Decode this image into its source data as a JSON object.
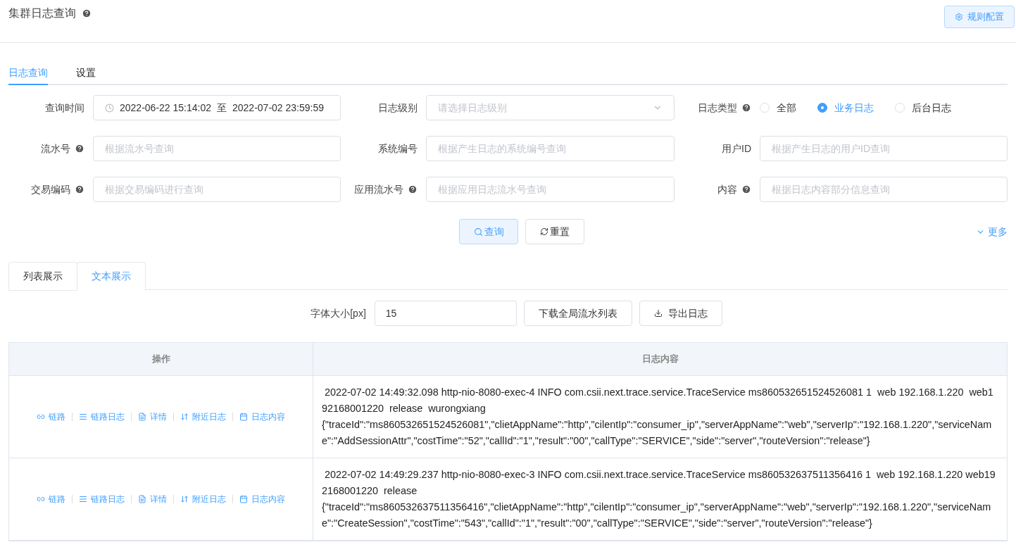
{
  "page": {
    "title": "集群日志查询",
    "config_button": "规则配置"
  },
  "tabs": [
    {
      "label": "日志查询",
      "selected": true
    },
    {
      "label": "设置",
      "selected": false
    }
  ],
  "form": {
    "rows": [
      [
        {
          "label": "查询时间",
          "help": false,
          "kind": "daterange",
          "start": "2022-06-22 15:14:02",
          "separator": "至",
          "end": "2022-07-02 23:59:59"
        },
        {
          "label": "日志级别",
          "help": false,
          "kind": "select",
          "placeholder": "请选择日志级别"
        },
        {
          "label": "日志类型",
          "help": true,
          "kind": "radio",
          "options": [
            {
              "label": "全部",
              "selected": false
            },
            {
              "label": "业务日志",
              "selected": true
            },
            {
              "label": "后台日志",
              "selected": false
            }
          ]
        }
      ],
      [
        {
          "label": "流水号",
          "help": true,
          "kind": "input",
          "placeholder": "根据流水号查询"
        },
        {
          "label": "系统编号",
          "help": false,
          "kind": "input",
          "placeholder": "根据产生日志的系统编号查询"
        },
        {
          "label": "用户ID",
          "help": false,
          "kind": "input",
          "placeholder": "根据产生日志的用户ID查询"
        }
      ],
      [
        {
          "label": "交易编码",
          "help": true,
          "kind": "input",
          "placeholder": "根据交易编码进行查询"
        },
        {
          "label": "应用流水号",
          "help": true,
          "kind": "input",
          "placeholder": "根据应用日志流水号查询"
        },
        {
          "label": "内容",
          "help": true,
          "kind": "input",
          "placeholder": "根据日志内容部分信息查询"
        }
      ]
    ],
    "search_button": "查询",
    "reset_button": "重置",
    "more_link": "更多"
  },
  "view_tabs": [
    {
      "label": "列表展示",
      "selected": false
    },
    {
      "label": "文本展示",
      "selected": true
    }
  ],
  "toolbar": {
    "font_size_label": "字体大小[px]",
    "font_size_value": "15",
    "download_button": "下载全局流水列表",
    "export_button": "导出日志"
  },
  "table": {
    "columns": [
      "操作",
      "日志内容"
    ],
    "rows": [
      {
        "actions": [
          {
            "kind": "link",
            "label": "链路"
          },
          {
            "kind": "list",
            "label": "链路日志"
          },
          {
            "kind": "doc",
            "label": "详情"
          },
          {
            "kind": "sort",
            "label": "附近日志"
          },
          {
            "kind": "calendar",
            "label": "日志内容"
          }
        ],
        "content": " 2022-07-02 14:49:32.098 http-nio-8080-exec-4 INFO com.csii.next.trace.service.TraceService ms860532651524526081 1  web 192.168.1.220  web192168001220  release  wurongxiang\n{\"traceId\":\"ms860532651524526081\",\"clietAppName\":\"http\",\"cilentIp\":\"consumer_ip\",\"serverAppName\":\"web\",\"serverIp\":\"192.168.1.220\",\"serviceName\":\"AddSessionAttr\",\"costTime\":\"52\",\"callId\":\"1\",\"result\":\"00\",\"callType\":\"SERVICE\",\"side\":\"server\",\"routeVersion\":\"release\"}"
      },
      {
        "actions": [
          {
            "kind": "link",
            "label": "链路"
          },
          {
            "kind": "list",
            "label": "链路日志"
          },
          {
            "kind": "doc",
            "label": "详情"
          },
          {
            "kind": "sort",
            "label": "附近日志"
          },
          {
            "kind": "calendar",
            "label": "日志内容"
          }
        ],
        "content": " 2022-07-02 14:49:29.237 http-nio-8080-exec-3 INFO com.csii.next.trace.service.TraceService ms860532637511356416 1  web 192.168.1.220 web192168001220  release\n{\"traceId\":\"ms860532637511356416\",\"clietAppName\":\"http\",\"cilentIp\":\"consumer_ip\",\"serverAppName\":\"web\",\"serverIp\":\"192.168.1.220\",\"serviceName\":\"CreateSession\",\"costTime\":\"543\",\"callId\":\"1\",\"result\":\"00\",\"callType\":\"SERVICE\",\"side\":\"server\",\"routeVersion\":\"release\"}"
      }
    ]
  }
}
